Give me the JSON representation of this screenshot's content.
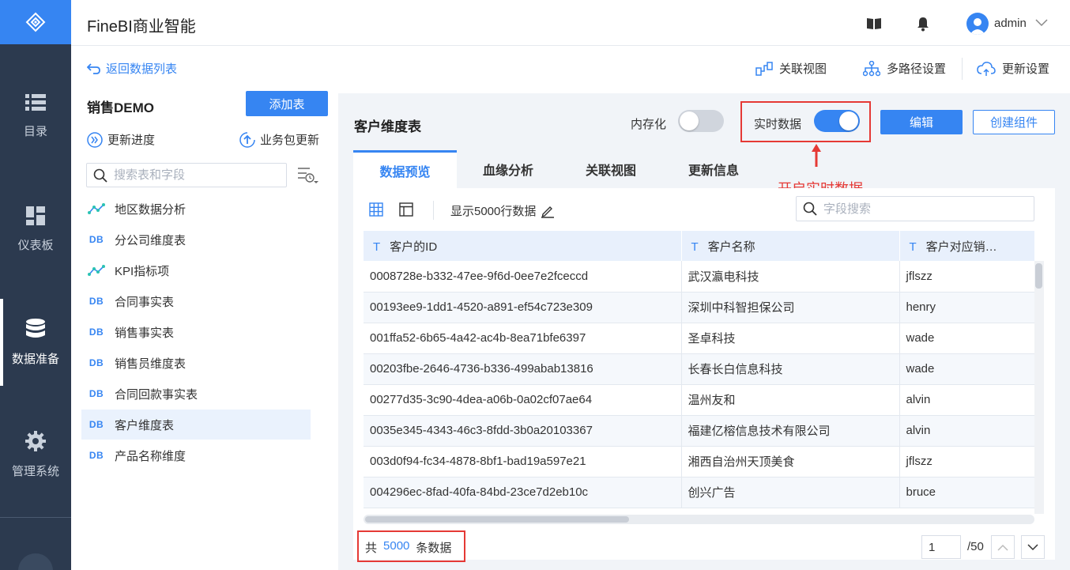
{
  "nav": {
    "items": [
      {
        "label": "目录",
        "icon": "list-icon"
      },
      {
        "label": "仪表板",
        "icon": "dashboard-icon"
      },
      {
        "label": "数据准备",
        "icon": "database-icon",
        "active": true
      },
      {
        "label": "管理系统",
        "icon": "gear-icon"
      }
    ]
  },
  "header": {
    "app_title": "FineBI商业智能",
    "username": "admin"
  },
  "left_panel": {
    "back_label": "返回数据列表",
    "package_name": "销售DEMO",
    "add_table_label": "添加表",
    "update_progress_label": "更新进度",
    "package_update_label": "业务包更新",
    "search_placeholder": "搜索表和字段",
    "tables": [
      {
        "name": "地区数据分析",
        "type": "analysis"
      },
      {
        "name": "分公司维度表",
        "type": "db",
        "tag": "DB"
      },
      {
        "name": "KPI指标项",
        "type": "analysis"
      },
      {
        "name": "合同事实表",
        "type": "db",
        "tag": "DB"
      },
      {
        "name": "销售事实表",
        "type": "db",
        "tag": "DB"
      },
      {
        "name": "销售员维度表",
        "type": "db",
        "tag": "DB"
      },
      {
        "name": "合同回款事实表",
        "type": "db",
        "tag": "DB"
      },
      {
        "name": "客户维度表",
        "type": "db",
        "tag": "DB",
        "selected": true
      },
      {
        "name": "产品名称维度",
        "type": "db",
        "tag": "DB"
      }
    ]
  },
  "top_actions": {
    "relation_view": "关联视图",
    "multipath": "多路径设置",
    "update_settings": "更新设置"
  },
  "main": {
    "table_title": "客户维度表",
    "memory_label": "内存化",
    "memory_on": false,
    "realtime_label": "实时数据",
    "realtime_on": true,
    "edit_label": "编辑",
    "create_label": "创建组件",
    "annotation": "开启实时数据",
    "tabs": [
      "数据预览",
      "血缘分析",
      "关联视图",
      "更新信息"
    ],
    "rows_label": "显示5000行数据",
    "field_search_placeholder": "字段搜索",
    "table": {
      "columns": [
        {
          "type": "T",
          "name": "客户的ID"
        },
        {
          "type": "T",
          "name": "客户名称"
        },
        {
          "type": "T",
          "name": "客户对应销…"
        }
      ],
      "rows": [
        [
          "0008728e-b332-47ee-9f6d-0ee7e2fceccd",
          "武汉瀛电科技",
          "jflszz"
        ],
        [
          "00193ee9-1dd1-4520-a891-ef54c723e309",
          "深圳中科智担保公司",
          "henry"
        ],
        [
          "001ffa52-6b65-4a42-ac4b-8ea71bfe6397",
          "圣卓科技",
          "wade"
        ],
        [
          "00203fbe-2646-4736-b336-499abab13816",
          "长春长白信息科技",
          "wade"
        ],
        [
          "00277d35-3c90-4dea-a06b-0a02cf07ae64",
          "温州友和",
          "alvin"
        ],
        [
          "0035e345-4343-46c3-8fdd-3b0a20103367",
          "福建亿榕信息技术有限公司",
          "alvin"
        ],
        [
          "003d0f94-fc34-4878-8bf1-bad19a597e21",
          "湘西自治州天顶美食",
          "jflszz"
        ],
        [
          "004296ec-8fad-40fa-84bd-23ce7d2eb10c",
          "创兴广告",
          "bruce"
        ]
      ]
    },
    "footer": {
      "total_prefix": "共",
      "total_count": "5000",
      "total_suffix": "条数据",
      "current_page": "1",
      "page_total": "/50"
    }
  },
  "colors": {
    "accent": "#3685f2",
    "nav_bg": "#2c3a4f",
    "highlight": "#e53935"
  }
}
